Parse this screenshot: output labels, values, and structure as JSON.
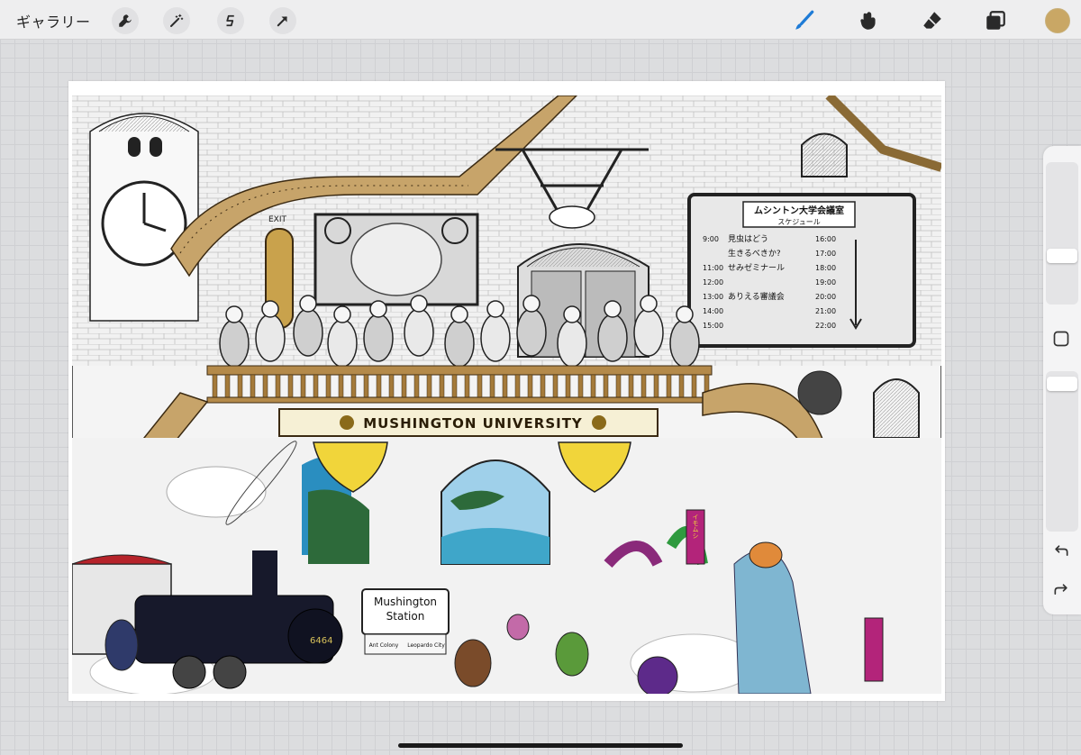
{
  "topbar": {
    "gallery_label": "ギャラリー",
    "left_tools": [
      {
        "name": "wrench-icon"
      },
      {
        "name": "magic-wand-icon"
      },
      {
        "name": "selection-icon"
      },
      {
        "name": "transform-arrow-icon"
      }
    ],
    "right_tools": [
      {
        "name": "brush-icon",
        "active": true,
        "color": "#1e7bd6"
      },
      {
        "name": "smudge-icon"
      },
      {
        "name": "eraser-icon"
      },
      {
        "name": "layers-icon"
      }
    ],
    "current_color": "#c9a765"
  },
  "artwork": {
    "sign_title": "MUSHINGTON UNIVERSITY",
    "board_title": "ムシントン大学会議室",
    "board_subtitle": "スケジュール",
    "schedule": [
      {
        "time": "9:00",
        "event": "見虫はどう"
      },
      {
        "time": "",
        "event": "生きるべきか?"
      },
      {
        "time": "11:00",
        "event": "せみゼミナール"
      },
      {
        "time": "12:00",
        "event": ""
      },
      {
        "time": "13:00",
        "event": "ありえる審議会"
      },
      {
        "time": "14:00",
        "event": ""
      },
      {
        "time": "15:00",
        "event": ""
      }
    ],
    "schedule_right_times": [
      "16:00",
      "17:00",
      "18:00",
      "19:00",
      "20:00",
      "21:00",
      "22:00"
    ],
    "station_sign": {
      "line1": "Mushington",
      "line2": "Station",
      "left_dest": "Ant Colony",
      "right_dest": "Leopardo City"
    },
    "banner_text": "イモムシ",
    "exit_label": "EXIT",
    "train_number": "6464"
  },
  "sidebar": {
    "undo_icon": "undo-icon",
    "redo_icon": "redo-icon",
    "modify_icon": "square-button-icon"
  }
}
